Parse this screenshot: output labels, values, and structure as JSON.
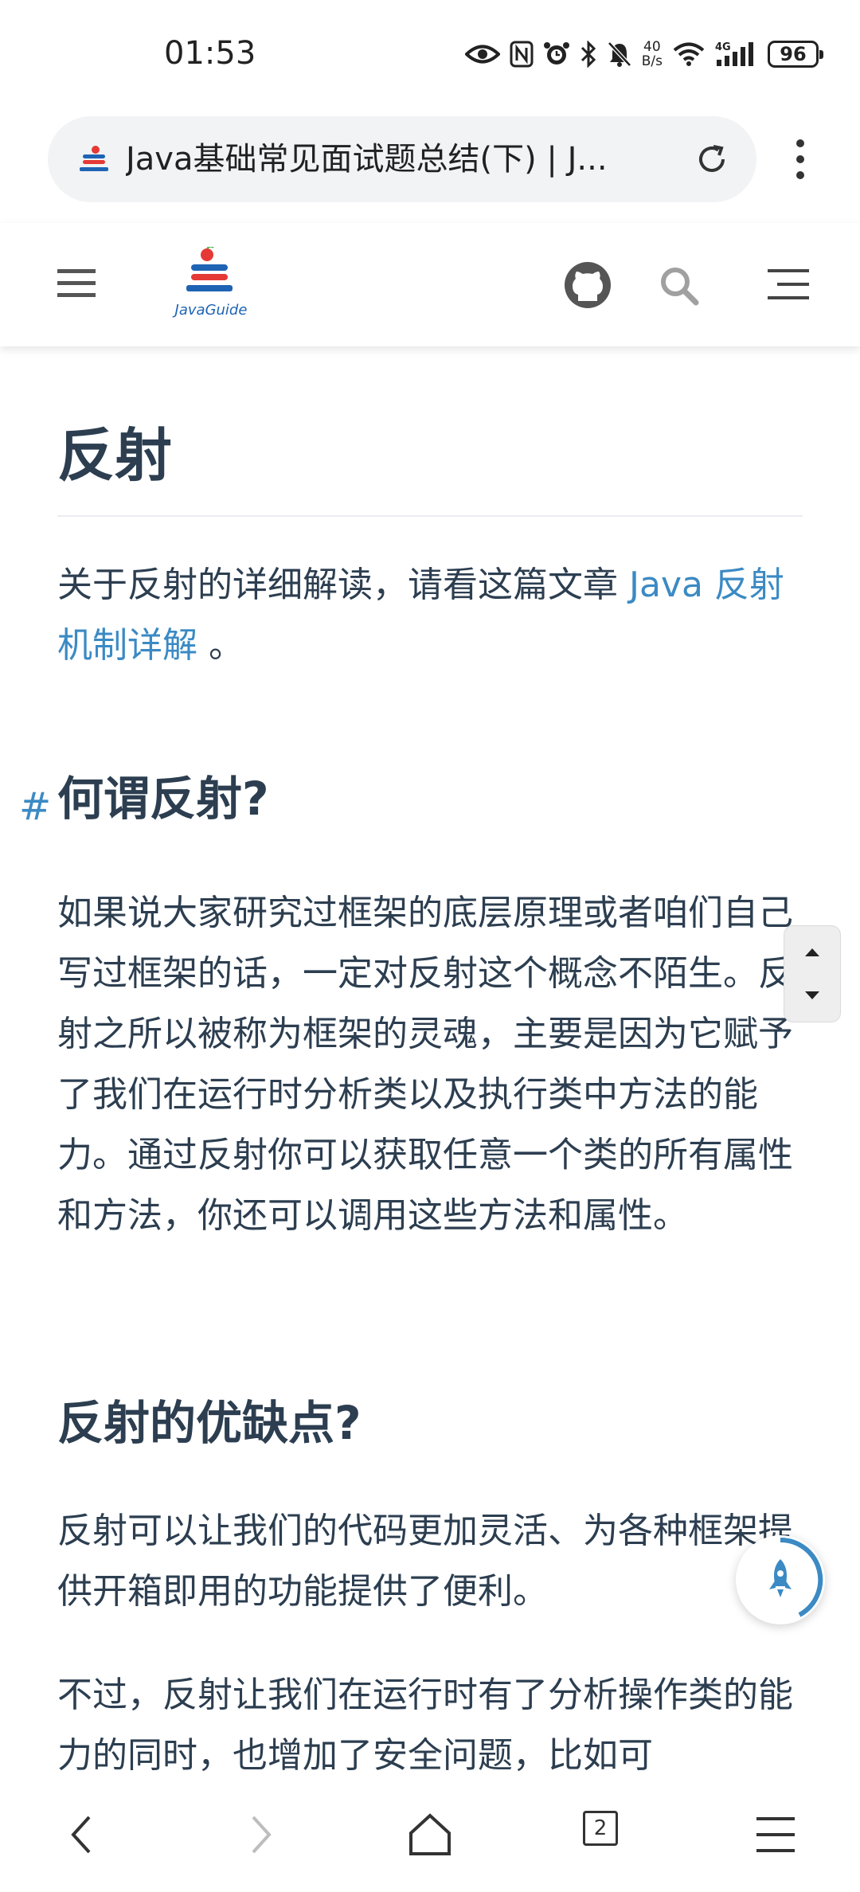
{
  "status_bar": {
    "time": "01:53",
    "net_speed_value": "40",
    "net_speed_unit": "B/s",
    "signal_label": "4G",
    "battery": "96",
    "icons": [
      "eye-icon",
      "nfc-icon",
      "alarm-icon",
      "bluetooth-icon",
      "mute-icon",
      "wifi-icon",
      "signal-icon"
    ]
  },
  "browser": {
    "url_title": "Java基础常见面试题总结(下) | J...",
    "tab_count": "2"
  },
  "site": {
    "logo_text": "JavaGuide"
  },
  "article": {
    "h1": "反射",
    "intro_prefix": "关于反射的详细解读，请看这篇文章 ",
    "intro_link": "Java 反射机制详解",
    "intro_suffix": " 。",
    "h2_what": "何谓反射?",
    "anchor": "#",
    "what_body": "如果说大家研究过框架的底层原理或者咱们自己写过框架的话，一定对反射这个概念不陌生。反射之所以被称为框架的灵魂，主要是因为它赋予了我们在运行时分析类以及执行类中方法的能力。通过反射你可以获取任意一个类的所有属性和方法，你还可以调用这些方法和属性。",
    "h2_pros_cons": "反射的优缺点?",
    "pros_body": "反射可以让我们的代码更加灵活、为各种框架提供开箱即用的功能提供了便利。",
    "cons_body": "不过，反射让我们在运行时有了分析操作类的能力的同时，也增加了安全问题，比如可"
  },
  "colors": {
    "text": "#2c3e50",
    "link": "#3b8ac4",
    "rule": "#eaecef"
  }
}
